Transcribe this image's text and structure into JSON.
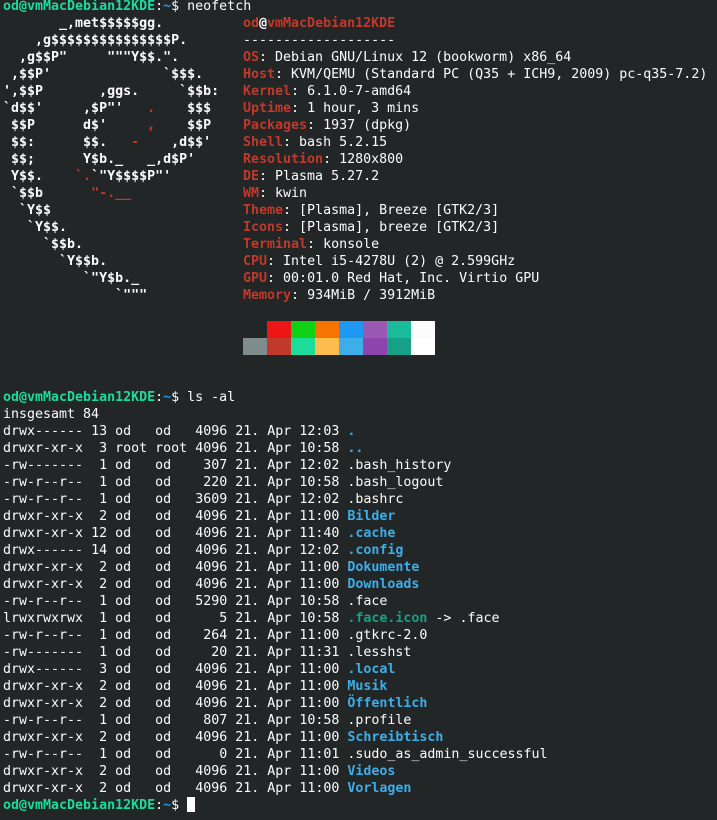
{
  "colors": {
    "background": "#232627",
    "foreground": "#fcfcfc",
    "prompt": "#1cdc9a",
    "path": "#1d99f3",
    "accent_red": "#c0392b",
    "directory": "#3daee9",
    "symlink": "#16a085"
  },
  "prompt": {
    "user_host": "od@vmMacDebian12KDE",
    "sep": ":",
    "path": "~",
    "symbol": "$ "
  },
  "commands": [
    "neofetch",
    "ls -al",
    ""
  ],
  "neofetch": {
    "logo": [
      [
        [
          "       _,met$$$$$gg.",
          ""
        ]
      ],
      [
        [
          "    ,g$$$$$$$$$$$$$$$P.",
          ""
        ]
      ],
      [
        [
          "  ,g$$P\"     \"\"\"Y$$.\".",
          ""
        ]
      ],
      [
        [
          " ,$$P'              `$$$.",
          ""
        ]
      ],
      [
        [
          "',$$P       ,ggs.     `$$b:",
          ""
        ]
      ],
      [
        [
          "`d$$'     ,$P\"'   ",
          ""
        ],
        [
          ".",
          "red"
        ],
        [
          "    $$$",
          ""
        ]
      ],
      [
        [
          " $$P      d$'     ",
          ""
        ],
        [
          ",",
          "red"
        ],
        [
          "    $$P",
          ""
        ]
      ],
      [
        [
          " $$:      $$.   ",
          ""
        ],
        [
          "-",
          "red"
        ],
        [
          "    ,d$$'",
          ""
        ]
      ],
      [
        [
          " $$;      Y$b._   _,d$P'",
          ""
        ]
      ],
      [
        [
          " Y$$.    ",
          ""
        ],
        [
          "`.",
          "red"
        ],
        [
          "`\"Y$$$$P\"'",
          ""
        ]
      ],
      [
        [
          " `$$b      ",
          ""
        ],
        [
          "\"-.__",
          "red"
        ]
      ],
      [
        [
          "  `Y$$",
          ""
        ]
      ],
      [
        [
          "   `Y$$.",
          ""
        ]
      ],
      [
        [
          "     `$$b.",
          ""
        ]
      ],
      [
        [
          "       `Y$$b.",
          ""
        ]
      ],
      [
        [
          "          `\"Y$b._",
          ""
        ]
      ],
      [
        [
          "              `\"\"\"",
          ""
        ]
      ]
    ],
    "user": "od",
    "at": "@",
    "host": "vmMacDebian12KDE",
    "separator": "-------------------",
    "fields": [
      {
        "label": "OS",
        "value": "Debian GNU/Linux 12 (bookworm) x86_64"
      },
      {
        "label": "Host",
        "value": "KVM/QEMU (Standard PC (Q35 + ICH9, 2009) pc-q35-7.2)"
      },
      {
        "label": "Kernel",
        "value": "6.1.0-7-amd64"
      },
      {
        "label": "Uptime",
        "value": "1 hour, 3 mins"
      },
      {
        "label": "Packages",
        "value": "1937 (dpkg)"
      },
      {
        "label": "Shell",
        "value": "bash 5.2.15"
      },
      {
        "label": "Resolution",
        "value": "1280x800"
      },
      {
        "label": "DE",
        "value": "Plasma 5.27.2"
      },
      {
        "label": "WM",
        "value": "kwin"
      },
      {
        "label": "Theme",
        "value": "[Plasma], Breeze [GTK2/3]"
      },
      {
        "label": "Icons",
        "value": "[Plasma], breeze [GTK2/3]"
      },
      {
        "label": "Terminal",
        "value": "konsole"
      },
      {
        "label": "CPU",
        "value": "Intel i5-4278U (2) @ 2.599GHz"
      },
      {
        "label": "GPU",
        "value": "00:01.0 Red Hat, Inc. Virtio GPU"
      },
      {
        "label": "Memory",
        "value": "934MiB / 3912MiB"
      }
    ],
    "palette_normal": [
      "#232627",
      "#ed1515",
      "#11d116",
      "#f67400",
      "#1d99f3",
      "#9b59b6",
      "#1abc9c",
      "#fcfcfc"
    ],
    "palette_bright": [
      "#7f8c8d",
      "#c0392b",
      "#1cdc9a",
      "#fdbc4b",
      "#3daee9",
      "#8e44ad",
      "#16a085",
      "#ffffff"
    ]
  },
  "ls": {
    "total": "insgesamt 84",
    "entries": [
      {
        "perms": "drwx------",
        "links": "13",
        "owner": "od",
        "group": "od",
        "size": "4096",
        "date": "21. Apr",
        "time": "12:03",
        "name": ".",
        "type": "dir"
      },
      {
        "perms": "drwxr-xr-x",
        "links": "3",
        "owner": "root",
        "group": "root",
        "size": "4096",
        "date": "21. Apr",
        "time": "10:58",
        "name": "..",
        "type": "dir"
      },
      {
        "perms": "-rw-------",
        "links": "1",
        "owner": "od",
        "group": "od",
        "size": "307",
        "date": "21. Apr",
        "time": "12:02",
        "name": ".bash_history",
        "type": "file"
      },
      {
        "perms": "-rw-r--r--",
        "links": "1",
        "owner": "od",
        "group": "od",
        "size": "220",
        "date": "21. Apr",
        "time": "10:58",
        "name": ".bash_logout",
        "type": "file"
      },
      {
        "perms": "-rw-r--r--",
        "links": "1",
        "owner": "od",
        "group": "od",
        "size": "3609",
        "date": "21. Apr",
        "time": "12:02",
        "name": ".bashrc",
        "type": "file"
      },
      {
        "perms": "drwxr-xr-x",
        "links": "2",
        "owner": "od",
        "group": "od",
        "size": "4096",
        "date": "21. Apr",
        "time": "11:00",
        "name": "Bilder",
        "type": "dir"
      },
      {
        "perms": "drwxr-xr-x",
        "links": "12",
        "owner": "od",
        "group": "od",
        "size": "4096",
        "date": "21. Apr",
        "time": "11:40",
        "name": ".cache",
        "type": "dir"
      },
      {
        "perms": "drwx------",
        "links": "14",
        "owner": "od",
        "group": "od",
        "size": "4096",
        "date": "21. Apr",
        "time": "12:02",
        "name": ".config",
        "type": "dir"
      },
      {
        "perms": "drwxr-xr-x",
        "links": "2",
        "owner": "od",
        "group": "od",
        "size": "4096",
        "date": "21. Apr",
        "time": "11:00",
        "name": "Dokumente",
        "type": "dir"
      },
      {
        "perms": "drwxr-xr-x",
        "links": "2",
        "owner": "od",
        "group": "od",
        "size": "4096",
        "date": "21. Apr",
        "time": "11:00",
        "name": "Downloads",
        "type": "dir"
      },
      {
        "perms": "-rw-r--r--",
        "links": "1",
        "owner": "od",
        "group": "od",
        "size": "5290",
        "date": "21. Apr",
        "time": "10:58",
        "name": ".face",
        "type": "file"
      },
      {
        "perms": "lrwxrwxrwx",
        "links": "1",
        "owner": "od",
        "group": "od",
        "size": "5",
        "date": "21. Apr",
        "time": "10:58",
        "name": ".face.icon",
        "type": "link",
        "target": ".face"
      },
      {
        "perms": "-rw-r--r--",
        "links": "1",
        "owner": "od",
        "group": "od",
        "size": "264",
        "date": "21. Apr",
        "time": "11:00",
        "name": ".gtkrc-2.0",
        "type": "file"
      },
      {
        "perms": "-rw-------",
        "links": "1",
        "owner": "od",
        "group": "od",
        "size": "20",
        "date": "21. Apr",
        "time": "11:31",
        "name": ".lesshst",
        "type": "file"
      },
      {
        "perms": "drwx------",
        "links": "3",
        "owner": "od",
        "group": "od",
        "size": "4096",
        "date": "21. Apr",
        "time": "11:00",
        "name": ".local",
        "type": "dir"
      },
      {
        "perms": "drwxr-xr-x",
        "links": "2",
        "owner": "od",
        "group": "od",
        "size": "4096",
        "date": "21. Apr",
        "time": "11:00",
        "name": "Musik",
        "type": "dir"
      },
      {
        "perms": "drwxr-xr-x",
        "links": "2",
        "owner": "od",
        "group": "od",
        "size": "4096",
        "date": "21. Apr",
        "time": "11:00",
        "name": "Öffentlich",
        "type": "dir"
      },
      {
        "perms": "-rw-r--r--",
        "links": "1",
        "owner": "od",
        "group": "od",
        "size": "807",
        "date": "21. Apr",
        "time": "10:58",
        "name": ".profile",
        "type": "file"
      },
      {
        "perms": "drwxr-xr-x",
        "links": "2",
        "owner": "od",
        "group": "od",
        "size": "4096",
        "date": "21. Apr",
        "time": "11:00",
        "name": "Schreibtisch",
        "type": "dir"
      },
      {
        "perms": "-rw-r--r--",
        "links": "1",
        "owner": "od",
        "group": "od",
        "size": "0",
        "date": "21. Apr",
        "time": "11:01",
        "name": ".sudo_as_admin_successful",
        "type": "file"
      },
      {
        "perms": "drwxr-xr-x",
        "links": "2",
        "owner": "od",
        "group": "od",
        "size": "4096",
        "date": "21. Apr",
        "time": "11:00",
        "name": "Videos",
        "type": "dir"
      },
      {
        "perms": "drwxr-xr-x",
        "links": "2",
        "owner": "od",
        "group": "od",
        "size": "4096",
        "date": "21. Apr",
        "time": "11:00",
        "name": "Vorlagen",
        "type": "dir"
      }
    ]
  }
}
